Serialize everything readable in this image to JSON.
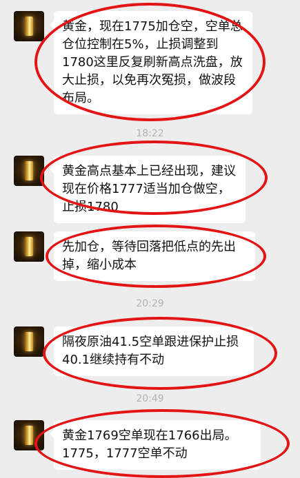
{
  "messages": [
    {
      "text": "黄金，现在1775加仓空，空单总仓位控制在5%，止损调整到1780这里反复刷新高点洗盘，放大止损，以免再次冤损，做波段布局。"
    },
    {
      "text": "黄金高点基本上已经出现，建议现在价格1777适当加仓做空，止损1780"
    },
    {
      "text": "先加仓，等待回落把低点的先出掉，缩小成本"
    },
    {
      "text": "隔夜原油41.5空单跟进保护止损40.1继续持有不动"
    },
    {
      "text": "黄金1769空单现在1766出局。1775，1777空单不动"
    }
  ],
  "timestamps": [
    "18:22",
    "20:29",
    "20:49"
  ],
  "colors": {
    "annotation_circle": "#e21414",
    "background": "#ededed",
    "bubble": "#ffffff"
  },
  "icons": {
    "avatar": "gold-bar-avatar-icon"
  }
}
